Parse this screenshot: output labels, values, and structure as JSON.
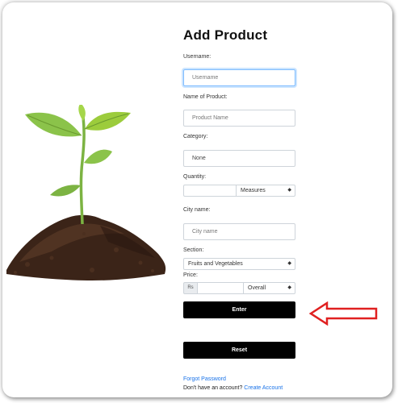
{
  "form": {
    "title": "Add Product",
    "username_label": "Username:",
    "username_placeholder": "Username",
    "product_name_label": "Name of Product:",
    "product_name_placeholder": "Product Name",
    "category_label": "Category:",
    "category_value": "None",
    "quantity_label": "Quantity:",
    "quantity_value": "",
    "measures_select": "Measures",
    "city_label": "City name:",
    "city_placeholder": "City name",
    "section_label": "Section:",
    "section_select": "Fruits and Vegetables",
    "price_label": "Price:",
    "price_prefix": "Rs",
    "price_value": "",
    "overall_select": "Overall",
    "enter_label": "Enter",
    "reset_label": "Reset",
    "forgot_password": "Forgot Password",
    "no_account_text": "Don't have an account?",
    "create_account": "Create Account"
  },
  "icons": {
    "select_arrow": "up-down-caret-icon",
    "annotation": "red-left-arrow-icon",
    "illustration": "plant-seedling-in-soil"
  },
  "colors": {
    "button_bg": "#000000",
    "link": "#1a73e8",
    "focus_border": "#80bdff",
    "annotation_arrow": "#e02020"
  }
}
